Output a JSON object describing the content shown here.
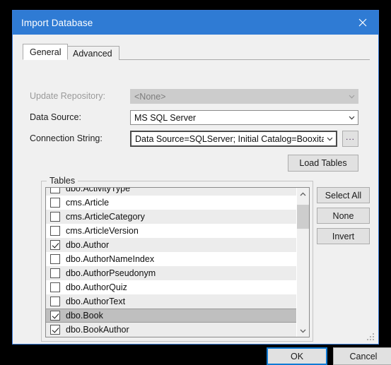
{
  "window": {
    "title": "Import Database",
    "close_icon": "close-icon"
  },
  "tabs": [
    {
      "label": "General",
      "selected": true
    },
    {
      "label": "Advanced",
      "selected": false
    }
  ],
  "form": {
    "update_repository": {
      "label": "Update Repository:",
      "value": "<None>",
      "disabled": true,
      "arrow_icon": "chevron-down-icon"
    },
    "data_source": {
      "label": "Data Source:",
      "value": "MS SQL Server",
      "disabled": false,
      "arrow_icon": "chevron-down-icon"
    },
    "connection_string": {
      "label": "Connection String:",
      "value": "Data Source=SQLServer; Initial Catalog=Booxita; Integrat",
      "disabled": false,
      "arrow_icon": "chevron-down-icon",
      "browse_label": "..."
    }
  },
  "actions": {
    "load_tables": "Load Tables",
    "select_all": "Select All",
    "none": "None",
    "invert": "Invert"
  },
  "tables_group": {
    "legend": "Tables",
    "rows": [
      {
        "label": "dbo.ActivityType",
        "checked": false,
        "selected": false,
        "clipped": true
      },
      {
        "label": "cms.Article",
        "checked": false,
        "selected": false
      },
      {
        "label": "cms.ArticleCategory",
        "checked": false,
        "selected": false
      },
      {
        "label": "cms.ArticleVersion",
        "checked": false,
        "selected": false
      },
      {
        "label": "dbo.Author",
        "checked": true,
        "selected": false
      },
      {
        "label": "dbo.AuthorNameIndex",
        "checked": false,
        "selected": false
      },
      {
        "label": "dbo.AuthorPseudonym",
        "checked": false,
        "selected": false
      },
      {
        "label": "dbo.AuthorQuiz",
        "checked": false,
        "selected": false
      },
      {
        "label": "dbo.AuthorText",
        "checked": false,
        "selected": false
      },
      {
        "label": "dbo.Book",
        "checked": true,
        "selected": true
      },
      {
        "label": "dbo.BookAuthor",
        "checked": true,
        "selected": false
      }
    ],
    "scrollbar": {
      "up_icon": "chevron-up-icon",
      "down_icon": "chevron-down-icon"
    }
  },
  "footer": {
    "ok": "OK",
    "cancel": "Cancel",
    "grip_icon": "resize-grip-icon"
  },
  "colors": {
    "accent": "#2f7bd4",
    "focus_border": "#0f7ad4",
    "dialog_bg": "#f0f0f0",
    "selection": "#bfbfbf",
    "row_alt": "#ececec"
  }
}
